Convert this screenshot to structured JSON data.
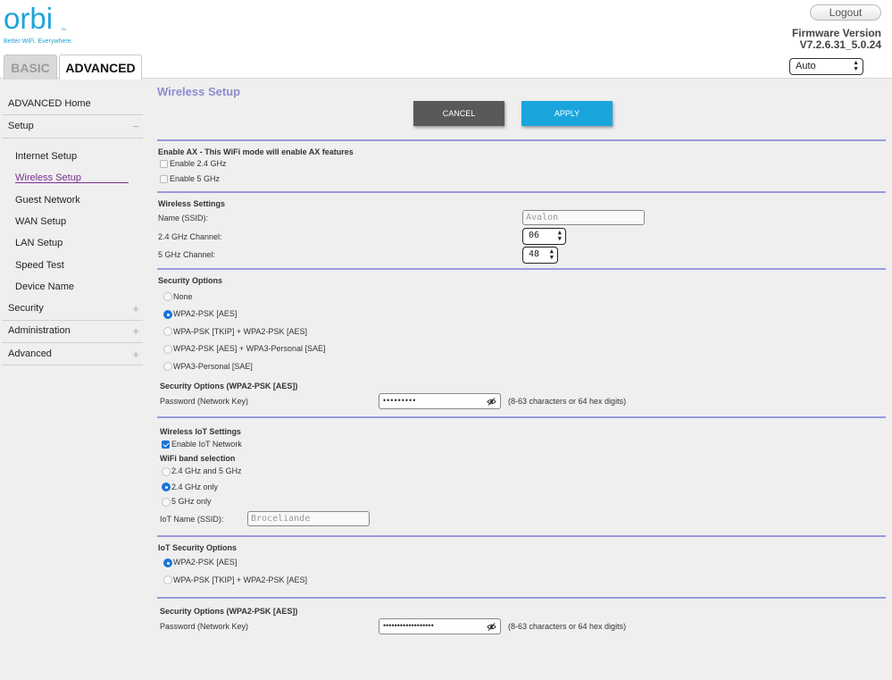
{
  "brand": {
    "logo_text": "orbi",
    "logo_tm": "TM",
    "tagline": "Better WiFi. Everywhere."
  },
  "header": {
    "logout_label": "Logout",
    "firmware_label": "Firmware Version",
    "firmware_version": "V7.2.6.31_5.0.24",
    "language_value": "Auto"
  },
  "tabs": {
    "basic": "BASIC",
    "advanced": "ADVANCED"
  },
  "sidebar": {
    "advanced_home": "ADVANCED Home",
    "setup": "Setup",
    "setup_sign": "−",
    "setup_items": [
      "Internet Setup",
      "Wireless Setup",
      "Guest Network",
      "WAN Setup",
      "LAN Setup",
      "Speed Test",
      "Device Name"
    ],
    "security": "Security",
    "administration": "Administration",
    "advanced": "Advanced",
    "collapsed_sign": "+"
  },
  "page": {
    "title": "Wireless Setup",
    "cancel_label": "CANCEL",
    "apply_label": "APPLY"
  },
  "ax": {
    "heading": "Enable AX - This WiFi mode will enable AX features",
    "enable_24": "Enable 2.4 GHz",
    "enable_5": "Enable 5 GHz"
  },
  "wireless_settings": {
    "heading": "Wireless Settings",
    "ssid_label": "Name (SSID):",
    "ssid_value": "Avalon",
    "ch24_label": "2.4 GHz Channel:",
    "ch24_value": "06",
    "ch5_label": "5 GHz Channel:",
    "ch5_value": "48"
  },
  "security_options": {
    "heading": "Security Options",
    "options": [
      "None",
      "WPA2-PSK [AES]",
      "WPA-PSK [TKIP] + WPA2-PSK [AES]",
      "WPA2-PSK [AES] + WPA3-Personal [SAE]",
      "WPA3-Personal [SAE]"
    ],
    "selected": "WPA2-PSK [AES]",
    "sub_heading": "Security Options (WPA2-PSK [AES])",
    "password_label": "Password (Network Key)",
    "password_mask": "•••••••••",
    "hint": "(8-63 characters or 64 hex digits)"
  },
  "iot": {
    "heading": "Wireless IoT Settings",
    "enable_label": "Enable IoT Network",
    "band_heading": "WiFi band selection",
    "bands": [
      "2.4 GHz and 5 GHz",
      "2.4 GHz only",
      "5 GHz only"
    ],
    "selected_band": "2.4 GHz only",
    "name_label": "IoT Name (SSID):",
    "name_value": "Broceliande"
  },
  "iot_security": {
    "heading": "IoT Security Options",
    "options": [
      "WPA2-PSK [AES]",
      "WPA-PSK [TKIP] + WPA2-PSK [AES]"
    ],
    "selected": "WPA2-PSK [AES]",
    "sub_heading": "Security Options (WPA2-PSK [AES])",
    "password_label": "Password (Network Key)",
    "password_mask": "••••••••••••••••••",
    "hint": "(8-63 characters or 64 hex digits)"
  },
  "colors": {
    "brand_blue": "#1ea4d8",
    "title_lavender": "#8c8ccf",
    "apply_blue": "#1aa6dc",
    "cancel_gray": "#595959",
    "active_nav_purple": "#7b2f8f",
    "divider_lavender": "#9a9ade",
    "check_blue": "#1a73d8"
  }
}
